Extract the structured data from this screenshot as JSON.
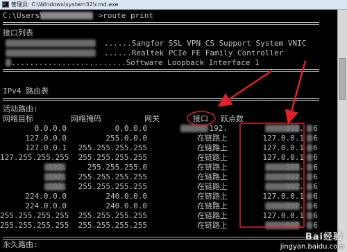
{
  "window": {
    "title": "管理员: C:\\Windows\\system32\\cmd.exe"
  },
  "console": {
    "prompt_prefix": "C:\\Users\\",
    "prompt_suffix": ">route print",
    "interface_list_header": "接口列表",
    "interfaces": [
      "......Sangfor SSL VPN CS Support System VNIC",
      "......Realtek PCIe FE Family Controller",
      ".........................Software Loopback Interface 1"
    ],
    "ipv4_header": "IPv4 路由表",
    "active_routes_header": "活动路由:",
    "persistent_routes_header": "永久路由:",
    "columns": [
      "网络目标",
      "网络掩码",
      "网关",
      "接口",
      "跃点数"
    ],
    "routes": [
      {
        "dest": "0.0.0.0",
        "mask": "0.0.0.0",
        "gateway": "192.",
        "iface": "192.",
        "metric": "6"
      },
      {
        "dest": "127.0.0.0",
        "mask": "255.0.0.0",
        "gateway": "在链路上",
        "iface": "127.0.0.1",
        "metric": "6"
      },
      {
        "dest": "127.0.0.1",
        "mask": "255.255.255.255",
        "gateway": "在链路上",
        "iface": "127.0.0.1",
        "metric": "6"
      },
      {
        "dest": "127.255.255.255",
        "mask": "255.255.255.255",
        "gateway": "在链路上",
        "iface": "127.0.0.1",
        "metric": "6"
      },
      {
        "dest": "192.",
        "mask": "255.255.255.0",
        "gateway": "在链路上",
        "iface": "192.",
        "metric": "6"
      },
      {
        "dest": "192.",
        "mask": "255.255.255.255",
        "gateway": "在链路上",
        "iface": "192.",
        "metric": "6"
      },
      {
        "dest": "192.",
        "mask": "255.255.255.255",
        "gateway": "在链路上",
        "iface": "192.",
        "metric": "6"
      },
      {
        "dest": "224.0.0.0",
        "mask": "240.0.0.0",
        "gateway": "在链路上",
        "iface": "127.0.0.1",
        "metric": "6"
      },
      {
        "dest": "224.0.0.0",
        "mask": "240.0.0.0",
        "gateway": "在链路上",
        "iface": "192.",
        "metric": "6"
      },
      {
        "dest": "255.255.255.255",
        "mask": "255.255.255.255",
        "gateway": "在链路上",
        "iface": "127.0.0.1",
        "metric": "6"
      },
      {
        "dest": "255.255.255.255",
        "mask": "255.255.255.255",
        "gateway": "在链路上",
        "iface": "192.",
        "metric": "6"
      }
    ]
  },
  "watermark": {
    "logo": "Bai经验",
    "url": "jingyan.baidu.com"
  },
  "colors": {
    "annotation": "#e0202a",
    "background": "#000000",
    "text": "#c0c0c0"
  }
}
